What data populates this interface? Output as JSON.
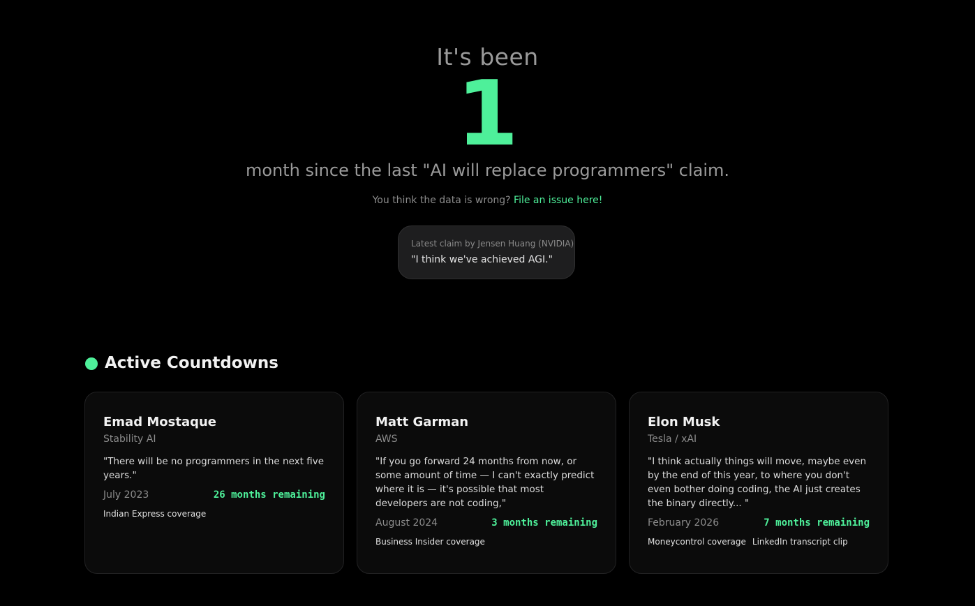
{
  "hero": {
    "intro": "It's been",
    "count": "1",
    "subtitle": "month since the last \"AI will replace programmers\" claim.",
    "issue_prompt": "You think the data is wrong?",
    "issue_link": "File an issue here!"
  },
  "latest_claim": {
    "label": "Latest claim by Jensen Huang (NVIDIA)",
    "quote": "\"I think we've achieved AGI.\""
  },
  "section": {
    "title": "Active Countdowns"
  },
  "cards": [
    {
      "name": "Emad Mostaque",
      "org": "Stability AI",
      "quote": "\"There will be no programmers in the next five years.\"",
      "date": "July 2023",
      "remaining": "26 months remaining",
      "links": [
        "Indian Express coverage"
      ]
    },
    {
      "name": "Matt Garman",
      "org": "AWS",
      "quote": "\"If you go forward 24 months from now, or some amount of time — I can't exactly predict where it is — it's possible that most developers are not coding,\"",
      "date": "August 2024",
      "remaining": "3 months remaining",
      "links": [
        "Business Insider coverage"
      ]
    },
    {
      "name": "Elon Musk",
      "org": "Tesla / xAI",
      "quote": "\"I think actually things will move, maybe even by the end of this year, to where you don't even bother doing coding, the AI just creates the binary directly... \"",
      "date": "February 2026",
      "remaining": "7 months remaining",
      "links": [
        "Moneycontrol coverage",
        "LinkedIn transcript clip"
      ]
    }
  ],
  "colors": {
    "accent": "#4ef09a",
    "background": "#000000",
    "card": "#0b0b0b"
  }
}
